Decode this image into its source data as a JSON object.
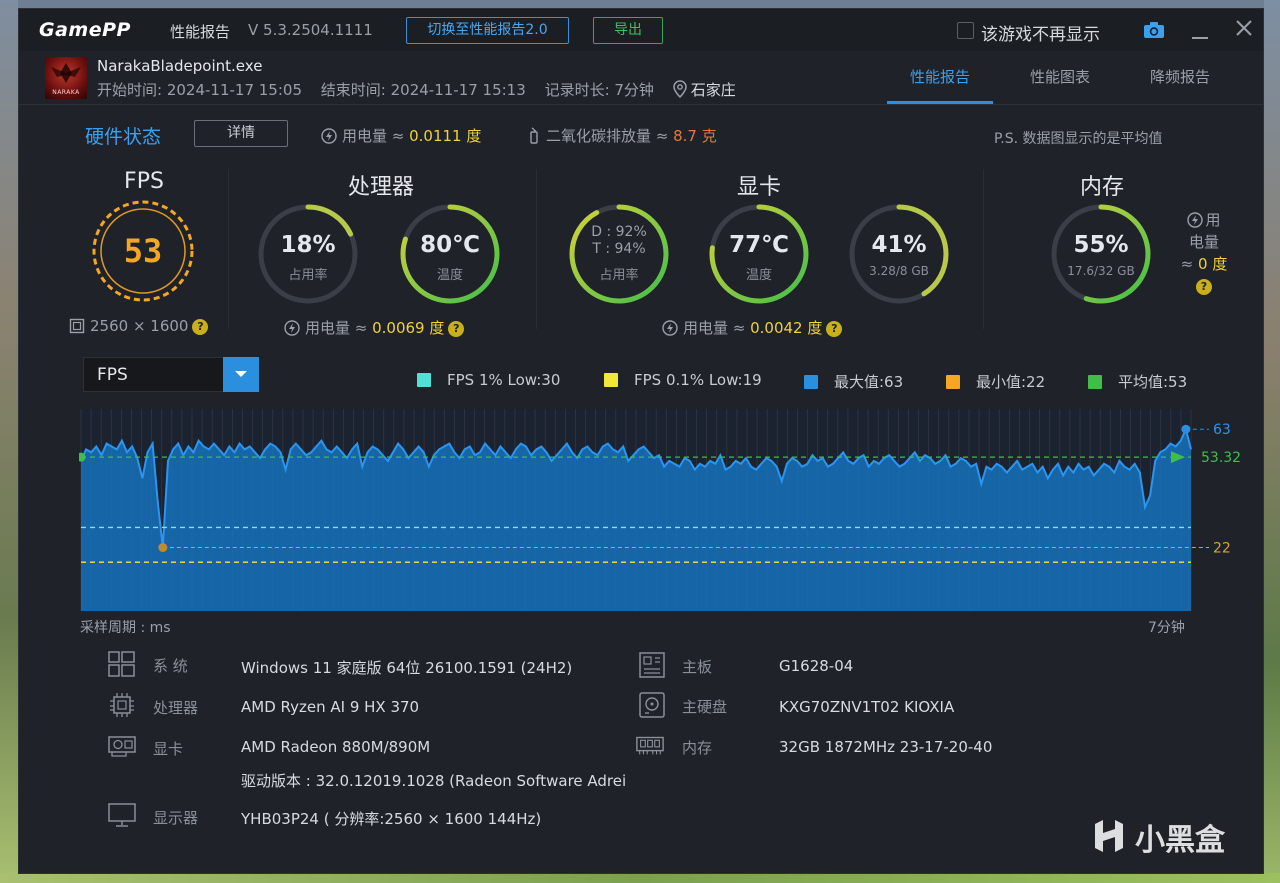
{
  "titlebar": {
    "logo": "GamePP",
    "report_label": "性能报告",
    "version": "V 5.3.2504.1111",
    "switch_button": "切换至性能报告2.0",
    "export_button": "导出",
    "hide_checkbox_label": "该游戏不再显示"
  },
  "game": {
    "exe": "NarakaBladepoint.exe",
    "icon_text": "NARAKA",
    "start_time": "开始时间: 2024-11-17 15:05",
    "end_time": "结束时间: 2024-11-17 15:13",
    "duration": "记录时长: 7分钟",
    "city": "石家庄"
  },
  "tabs": [
    {
      "label": "性能报告",
      "active": true
    },
    {
      "label": "性能图表",
      "active": false
    },
    {
      "label": "降频报告",
      "active": false
    }
  ],
  "hardware": {
    "title": "硬件状态",
    "detail_button": "详情",
    "power_label": "用电量 ≈ ",
    "power_value": "0.0111 度",
    "co2_label": "二氧化碳排放量 ≈ ",
    "co2_value": "8.7 克",
    "ps_note": "P.S. 数据图显示的是平均值"
  },
  "fps": {
    "title": "FPS",
    "value": "53",
    "resolution": "2560 × 1600",
    "color": "#f5a623"
  },
  "cpu": {
    "title": "处理器",
    "usage": {
      "value": "18%",
      "label": "占用率",
      "percent": 18
    },
    "temp": {
      "value": "80℃",
      "label": "温度",
      "percent": 80
    },
    "power_label": "用电量 ≈ ",
    "power_value": "0.0069 度"
  },
  "gpu": {
    "title": "显卡",
    "usage": {
      "d": "D : 92%",
      "t": "T : 94%",
      "label": "占用率",
      "percent": 92
    },
    "temp": {
      "value": "77℃",
      "label": "温度",
      "percent": 77
    },
    "vram": {
      "value": "41%",
      "label": "3.28/8 GB",
      "percent": 41
    },
    "power_label": "用电量 ≈ ",
    "power_value": "0.0042 度"
  },
  "memory": {
    "title": "内存",
    "usage": {
      "value": "55%",
      "label": "17.6/32 GB",
      "percent": 55
    },
    "power_line1": "用",
    "power_line2": "电量",
    "power_prefix": "≈ ",
    "power_value": "0 度"
  },
  "chart_controls": {
    "metric": "FPS",
    "legend": [
      {
        "label": "FPS 1% Low:30",
        "color": "#4fe0d8"
      },
      {
        "label": "FPS 0.1% Low:19",
        "color": "#f2e83a"
      },
      {
        "label": "最大值:63",
        "color": "#2b8fe0"
      },
      {
        "label": "最小值:22",
        "color": "#f5a623"
      },
      {
        "label": "平均值:53",
        "color": "#3fbf4a"
      }
    ]
  },
  "chart_data": {
    "type": "area",
    "title": "",
    "xlabel": "采样周期 : ms",
    "x_end_label": "7分钟",
    "ylim": [
      0,
      70
    ],
    "max": 63,
    "min": 22,
    "avg": 53.32,
    "low_1pct": 30,
    "low_01pct": 19,
    "labels": {
      "max": "63",
      "avg": "53.32",
      "min": "22"
    },
    "series": [
      {
        "values": [
          52,
          56,
          55,
          57,
          54,
          58,
          57,
          56,
          59,
          55,
          57,
          53,
          46,
          55,
          58,
          38,
          22,
          52,
          56,
          58,
          54,
          57,
          55,
          59,
          57,
          56,
          58,
          56,
          54,
          57,
          55,
          58,
          56,
          57,
          55,
          53,
          56,
          58,
          57,
          55,
          49,
          56,
          58,
          56,
          54,
          55,
          57,
          59,
          56,
          55,
          57,
          55,
          53,
          56,
          58,
          50,
          55,
          57,
          56,
          54,
          52,
          55,
          58,
          56,
          53,
          55,
          57,
          55,
          50,
          54,
          56,
          57,
          58,
          55,
          53,
          56,
          57,
          54,
          55,
          58,
          56,
          54,
          57,
          55,
          53,
          56,
          58,
          57,
          54,
          56,
          57,
          55,
          52,
          54,
          56,
          58,
          55,
          53,
          56,
          57,
          55,
          54,
          57,
          58,
          56,
          55,
          57,
          52,
          54,
          56,
          57,
          55,
          53,
          54,
          50,
          52,
          51,
          50,
          53,
          52,
          49,
          51,
          50,
          52,
          51,
          54,
          49,
          50,
          52,
          51,
          53,
          50,
          49,
          51,
          53,
          52,
          50,
          45,
          51,
          53,
          52,
          50,
          51,
          54,
          52,
          53,
          50,
          51,
          53,
          55,
          52,
          51,
          53,
          54,
          50,
          52,
          51,
          53,
          54,
          52,
          50,
          51,
          53,
          55,
          52,
          54,
          53,
          51,
          52,
          54,
          50,
          51,
          53,
          52,
          50,
          51,
          44,
          50,
          49,
          51,
          50,
          48,
          50,
          52,
          49,
          50,
          51,
          48,
          50,
          46,
          49,
          51,
          47,
          50,
          48,
          51,
          49,
          50,
          47,
          49,
          51,
          50,
          48,
          52,
          50,
          49,
          51,
          48,
          36,
          40,
          52,
          55,
          56,
          58,
          57,
          59,
          63,
          56
        ]
      }
    ]
  },
  "system_info": {
    "left": [
      {
        "key": "系  统",
        "value": "Windows 11 家庭版 64位 26100.1591 (24H2)",
        "icon": "windows-icon"
      },
      {
        "key": "处理器",
        "value": "AMD Ryzen AI 9 HX 370",
        "icon": "cpu-chip-icon"
      },
      {
        "key": "显卡",
        "value": "AMD Radeon 880M/890M",
        "icon": "gpu-card-icon"
      },
      {
        "key": "",
        "value": "驱动版本 : 32.0.12019.1028 (Radeon Software Adrei",
        "icon": ""
      },
      {
        "key": "显示器",
        "value": "YHB03P24 ( 分辨率:2560 × 1600 144Hz)",
        "icon": "monitor-icon"
      }
    ],
    "right": [
      {
        "key": "主板",
        "value": "G1628-04",
        "icon": "motherboard-icon"
      },
      {
        "key": "主硬盘",
        "value": "KXG70ZNV1T02 KIOXIA",
        "icon": "disk-icon"
      },
      {
        "key": "内存",
        "value": "32GB 1872MHz 23-17-20-40",
        "icon": "ram-icon"
      }
    ]
  },
  "watermark": "小黑盒"
}
